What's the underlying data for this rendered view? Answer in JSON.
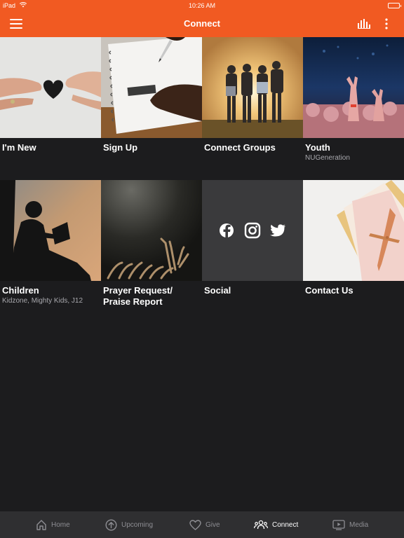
{
  "status": {
    "device": "iPad",
    "time": "10:26 AM",
    "battery_level": 1.0
  },
  "header": {
    "title": "Connect"
  },
  "tiles": [
    {
      "title": "I'm New",
      "subtitle": ""
    },
    {
      "title": "Sign Up",
      "subtitle": ""
    },
    {
      "title": "Connect Groups",
      "subtitle": ""
    },
    {
      "title": "Youth",
      "subtitle": "NUGeneration"
    },
    {
      "title": "Children",
      "subtitle": "Kidzone, Mighty Kids, J12"
    },
    {
      "title": "Prayer Request/ Praise Report",
      "subtitle": ""
    },
    {
      "title": "Social",
      "subtitle": ""
    },
    {
      "title": "Contact Us",
      "subtitle": ""
    }
  ],
  "social_icons": [
    "facebook-icon",
    "instagram-icon",
    "twitter-icon"
  ],
  "tabs": [
    {
      "label": "Home",
      "icon": "home-icon",
      "active": false
    },
    {
      "label": "Upcoming",
      "icon": "arrow-up-circle-icon",
      "active": false
    },
    {
      "label": "Give",
      "icon": "heart-icon",
      "active": false
    },
    {
      "label": "Connect",
      "icon": "people-icon",
      "active": true
    },
    {
      "label": "Media",
      "icon": "tv-play-icon",
      "active": false
    }
  ],
  "colors": {
    "accent": "#f15a22",
    "background": "#1c1c1e",
    "tabbar": "#2f2f31",
    "social_tile": "#3a3a3c"
  }
}
